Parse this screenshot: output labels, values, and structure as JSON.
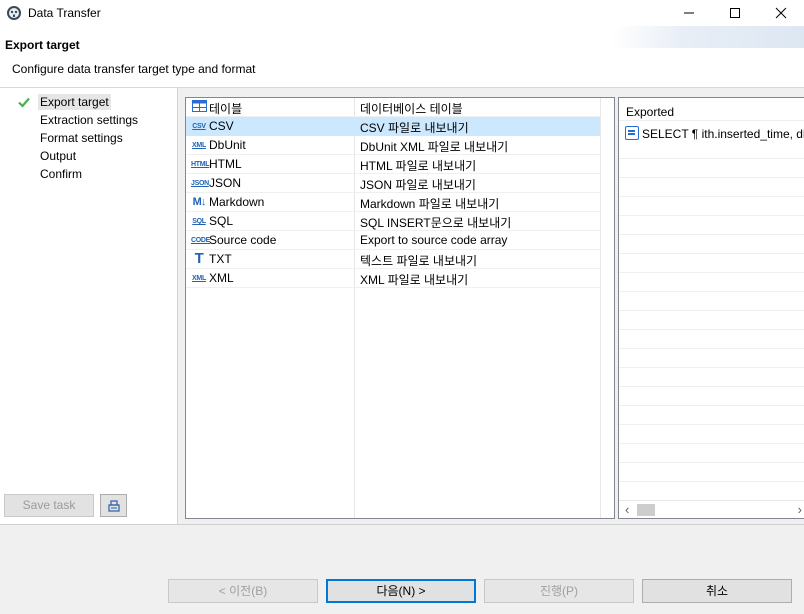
{
  "window": {
    "title": "Data Transfer",
    "icons": {
      "app": "dbeaver-app-icon",
      "minimize": "minimize-icon",
      "maximize": "maximize-icon",
      "close": "close-icon"
    }
  },
  "header": {
    "title": "Export target",
    "description": "Configure data transfer target type and format"
  },
  "nav": {
    "items": [
      {
        "label": "Export target",
        "selected": true,
        "done": true
      },
      {
        "label": "Extraction settings",
        "selected": false
      },
      {
        "label": "Format settings",
        "selected": false
      },
      {
        "label": "Output",
        "selected": false
      },
      {
        "label": "Confirm",
        "selected": false
      }
    ],
    "save_task_label": "Save task",
    "save_task_icon": "task-config-icon"
  },
  "formats": {
    "columns": [
      "테이블",
      "데이터베이스 테이블"
    ],
    "rows": [
      {
        "name": "CSV",
        "desc": "CSV 파일로 내보내기",
        "icon": "csv-icon",
        "selected": true
      },
      {
        "name": "DbUnit",
        "desc": "DbUnit XML 파일로 내보내기",
        "icon": "xml-icon"
      },
      {
        "name": "HTML",
        "desc": "HTML 파일로 내보내기",
        "icon": "html-icon"
      },
      {
        "name": "JSON",
        "desc": "JSON 파일로 내보내기",
        "icon": "json-icon"
      },
      {
        "name": "Markdown",
        "desc": "Markdown 파일로 내보내기",
        "icon": "markdown-icon"
      },
      {
        "name": "SQL",
        "desc": "SQL INSERT문으로 내보내기",
        "icon": "sql-icon"
      },
      {
        "name": "Source code",
        "desc": "Export to source code array",
        "icon": "code-icon"
      },
      {
        "name": "TXT",
        "desc": "텍스트 파일로 내보내기",
        "icon": "txt-icon"
      },
      {
        "name": "XML",
        "desc": "XML 파일로 내보내기",
        "icon": "xml-icon"
      }
    ]
  },
  "exported": {
    "header": "Exported",
    "item": "SELECT ¶ ith.inserted_time, di",
    "item_icon": "sql-query-icon"
  },
  "footer": {
    "back": "< 이전(B)",
    "next": "다음(N) >",
    "proceed": "진행(P)",
    "cancel": "취소"
  },
  "colors": {
    "selection": "#cce8ff",
    "accent": "#0078d7",
    "check": "#4caf50",
    "icon_blue": "#1f63b5"
  }
}
